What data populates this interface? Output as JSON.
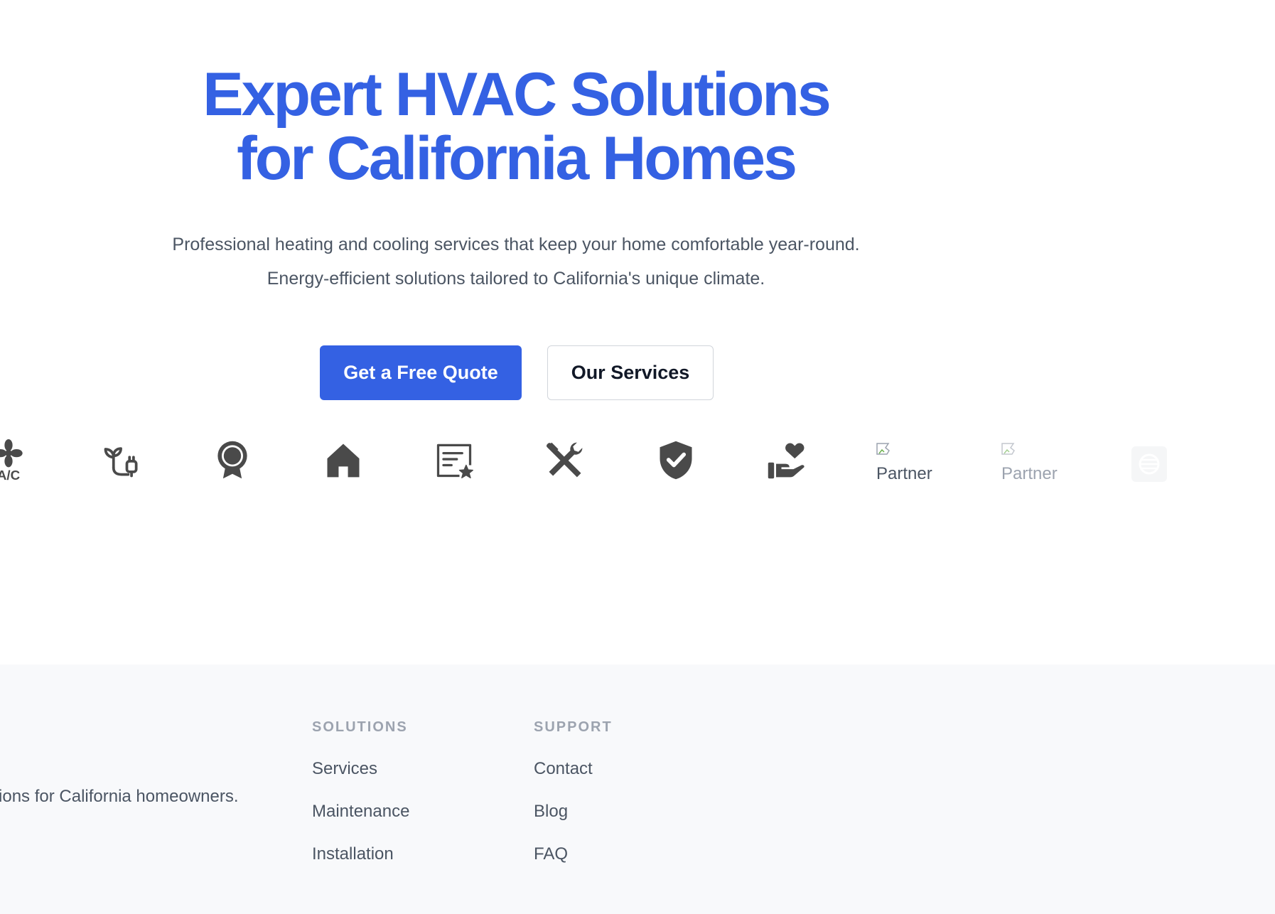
{
  "hero": {
    "title_line1": "Expert HVAC Solutions",
    "title_line2": "for California Homes",
    "subtitle": "Professional heating and cooling services that keep your home comfortable year-round. Energy-efficient solutions tailored to California's unique climate.",
    "primary_button": "Get a Free Quote",
    "secondary_button": "Our Services",
    "accent_color": "#3461e3"
  },
  "logo_strip": {
    "ac_label": "A/C",
    "icons": [
      "ac-fan-icon",
      "plant-plug-icon",
      "award-ribbon-icon",
      "home-icon",
      "certificate-icon",
      "tools-icon",
      "shield-check-icon",
      "hand-heart-icon"
    ],
    "partners": [
      "Partner",
      "Partner"
    ]
  },
  "footer": {
    "description": "utions for California homeowners.",
    "solutions": {
      "heading": "SOLUTIONS",
      "links": [
        "Services",
        "Maintenance",
        "Installation"
      ]
    },
    "support": {
      "heading": "SUPPORT",
      "links": [
        "Contact",
        "Blog",
        "FAQ"
      ]
    }
  }
}
